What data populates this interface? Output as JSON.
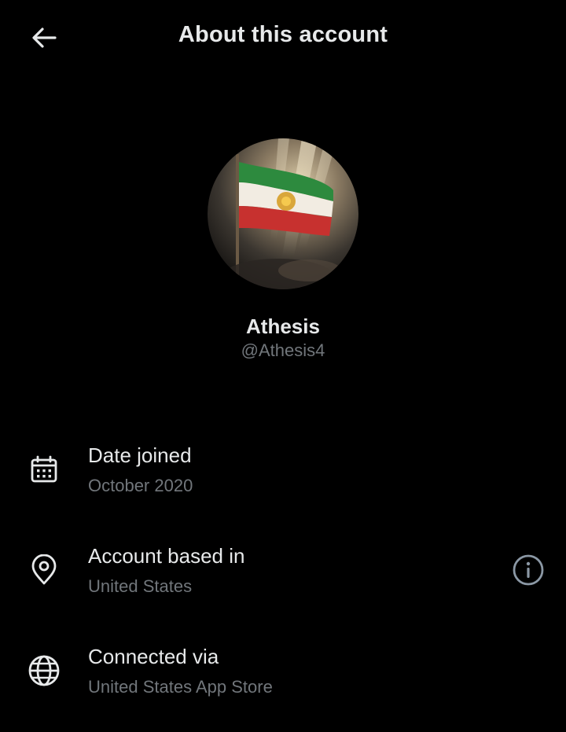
{
  "header": {
    "title": "About this account",
    "back_icon": "arrow-left-icon"
  },
  "profile": {
    "display_name": "Athesis",
    "handle": "@Athesis4",
    "avatar_description_icon": "flag-avatar"
  },
  "details": [
    {
      "icon": "calendar-icon",
      "label": "Date joined",
      "value": "October 2020"
    },
    {
      "icon": "location-pin-icon",
      "label": "Account based in",
      "value": "United States"
    },
    {
      "icon": "globe-icon",
      "label": "Connected via",
      "value": "United States App Store"
    }
  ],
  "info_icon": "info-icon",
  "colors": {
    "background": "#000000",
    "primary_text": "#e7e9ea",
    "secondary_text": "#71767b"
  }
}
